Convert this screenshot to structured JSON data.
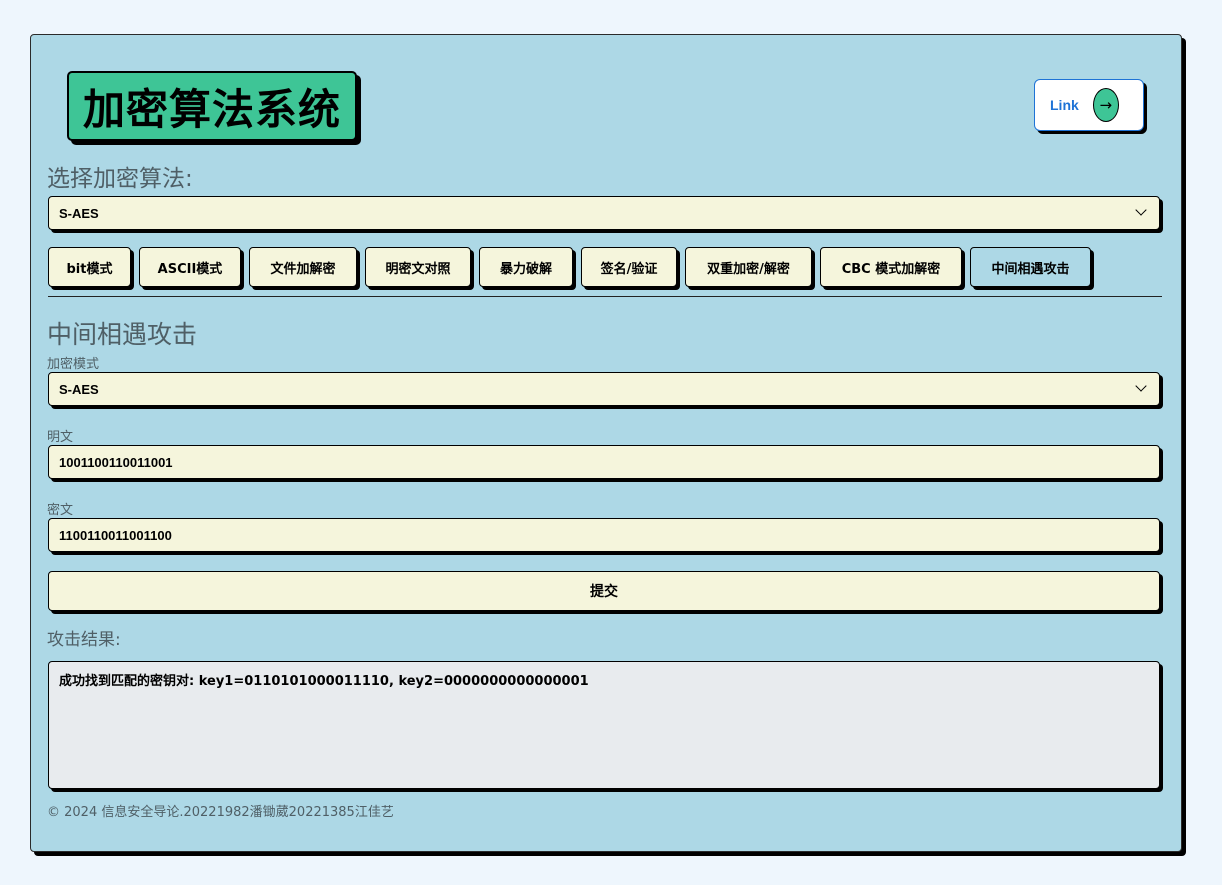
{
  "header": {
    "title": "加密算法系统",
    "link_label": "Link",
    "link_icon": "arrow-right-icon"
  },
  "algorithm": {
    "label": "选择加密算法:",
    "selected": "S-AES"
  },
  "tabs": [
    {
      "label": "bit模式",
      "active": false
    },
    {
      "label": "ASCII模式",
      "active": false
    },
    {
      "label": "文件加解密",
      "active": false
    },
    {
      "label": "明密文对照",
      "active": false
    },
    {
      "label": "暴力破解",
      "active": false
    },
    {
      "label": "签名/验证",
      "active": false
    },
    {
      "label": "双重加密/解密",
      "active": false
    },
    {
      "label": "CBC 模式加解密",
      "active": false
    },
    {
      "label": "中间相遇攻击",
      "active": true
    }
  ],
  "panel": {
    "heading": "中间相遇攻击",
    "mode_label": "加密模式",
    "mode_selected": "S-AES",
    "plaintext_label": "明文",
    "plaintext_value": "1001100110011001",
    "ciphertext_label": "密文",
    "ciphertext_value": "1100110011001100",
    "submit_label": "提交",
    "result_label": "攻击结果:",
    "result_text": "成功找到匹配的密钥对: key1=0110101000011110, key2=0000000000000001"
  },
  "footer": {
    "text": "© 2024 信息安全导论.20221982潘锄葳20221385江佳艺"
  },
  "colors": {
    "page_bg": "#eef6fd",
    "card_bg": "#add8e6",
    "title_bg": "#3ec596",
    "field_bg": "#f5f5dc",
    "result_bg": "#e8ebee",
    "link_text": "#1e73d6",
    "muted_text": "#4f5f66"
  }
}
